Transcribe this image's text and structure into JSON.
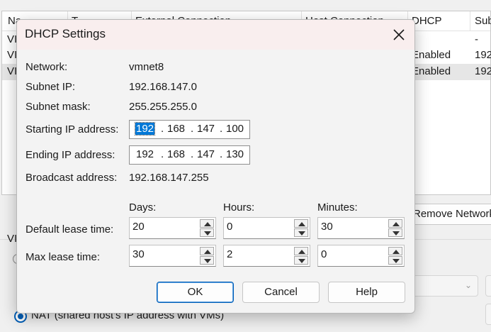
{
  "background": {
    "columns": [
      "Na",
      "T",
      "External Connection",
      "Host Connection",
      "DHCP",
      "Sub"
    ],
    "rows": [
      {
        "name": "VI",
        "dhcp": "",
        "subnet": "-"
      },
      {
        "name": "VI",
        "dhcp": "Enabled",
        "subnet": "192"
      },
      {
        "name": "VI",
        "dhcp": "Enabled",
        "subnet": "192"
      }
    ],
    "remove_network_label": "Remove Network",
    "vi_label": "VI",
    "nat_label": "NAT (shared host's IP address with VMs)"
  },
  "dialog": {
    "title": "DHCP Settings",
    "close_icon": "close-icon",
    "network_label": "Network:",
    "network_value": "vmnet8",
    "subnet_ip_label": "Subnet IP:",
    "subnet_ip_value": "192.168.147.0",
    "subnet_mask_label": "Subnet mask:",
    "subnet_mask_value": "255.255.255.0",
    "starting_ip_label": "Starting IP address:",
    "starting_ip": [
      "192",
      "168",
      "147",
      "100"
    ],
    "ending_ip_label": "Ending IP address:",
    "ending_ip": [
      "192",
      "168",
      "147",
      "130"
    ],
    "broadcast_label": "Broadcast address:",
    "broadcast_value": "192.168.147.255",
    "days_header": "Days:",
    "hours_header": "Hours:",
    "minutes_header": "Minutes:",
    "default_lease_label": "Default lease time:",
    "default_lease": {
      "days": "20",
      "hours": "0",
      "minutes": "30"
    },
    "max_lease_label": "Max lease time:",
    "max_lease": {
      "days": "30",
      "hours": "2",
      "minutes": "0"
    },
    "ok_label": "OK",
    "cancel_label": "Cancel",
    "help_label": "Help"
  },
  "colors": {
    "accent": "#005fb8",
    "selection": "#0078d7",
    "titlebar": "#f9eeee"
  }
}
